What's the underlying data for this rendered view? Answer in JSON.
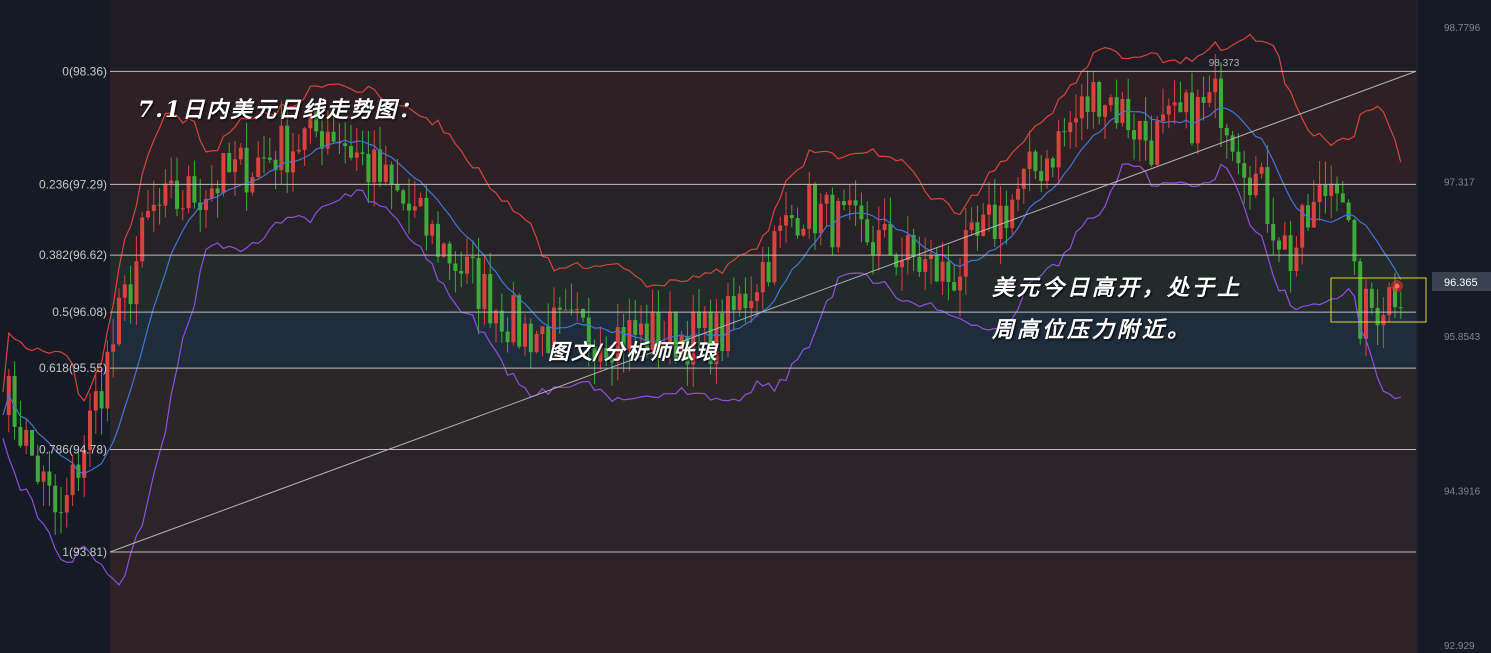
{
  "chart_data": {
    "type": "candlestick",
    "title": "7.1日内美元日线走势图：",
    "annotations": [
      "图文/分析师张琅",
      "美元今日高开，处于上",
      "周高位压力附近。"
    ],
    "fib_levels": [
      {
        "label": "0(98.36)",
        "ratio": 0,
        "price": 98.36
      },
      {
        "label": "0.236(97.29)",
        "ratio": 0.236,
        "price": 97.29
      },
      {
        "label": "0.382(96.62)",
        "ratio": 0.382,
        "price": 96.62
      },
      {
        "label": "0.5(96.08)",
        "ratio": 0.5,
        "price": 96.08
      },
      {
        "label": "0.618(95.55)",
        "ratio": 0.618,
        "price": 95.55
      },
      {
        "label": "0.786(94.78)",
        "ratio": 0.786,
        "price": 94.78
      },
      {
        "label": "1(93.81)",
        "ratio": 1,
        "price": 93.81
      }
    ],
    "right_axis_ticks": [
      "98.7796",
      "97.317",
      "95.8543",
      "94.3916",
      "92.929"
    ],
    "right_axis_values": [
      98.7796,
      97.317,
      95.8543,
      94.3916,
      92.929
    ],
    "current_price": "96.365",
    "current_price_value": 96.365,
    "peak_label": "98.373",
    "peak_value": 98.373,
    "y_range": [
      92.929,
      98.7796
    ],
    "colors": {
      "up": "#d9433d",
      "down": "#3faa3a",
      "upper_band": "#d9433d",
      "middle_band": "#3f77d8",
      "lower_band": "#8f4fe0",
      "trendline": "#b4b4b4",
      "highlight_box": "#e2d52b"
    }
  }
}
